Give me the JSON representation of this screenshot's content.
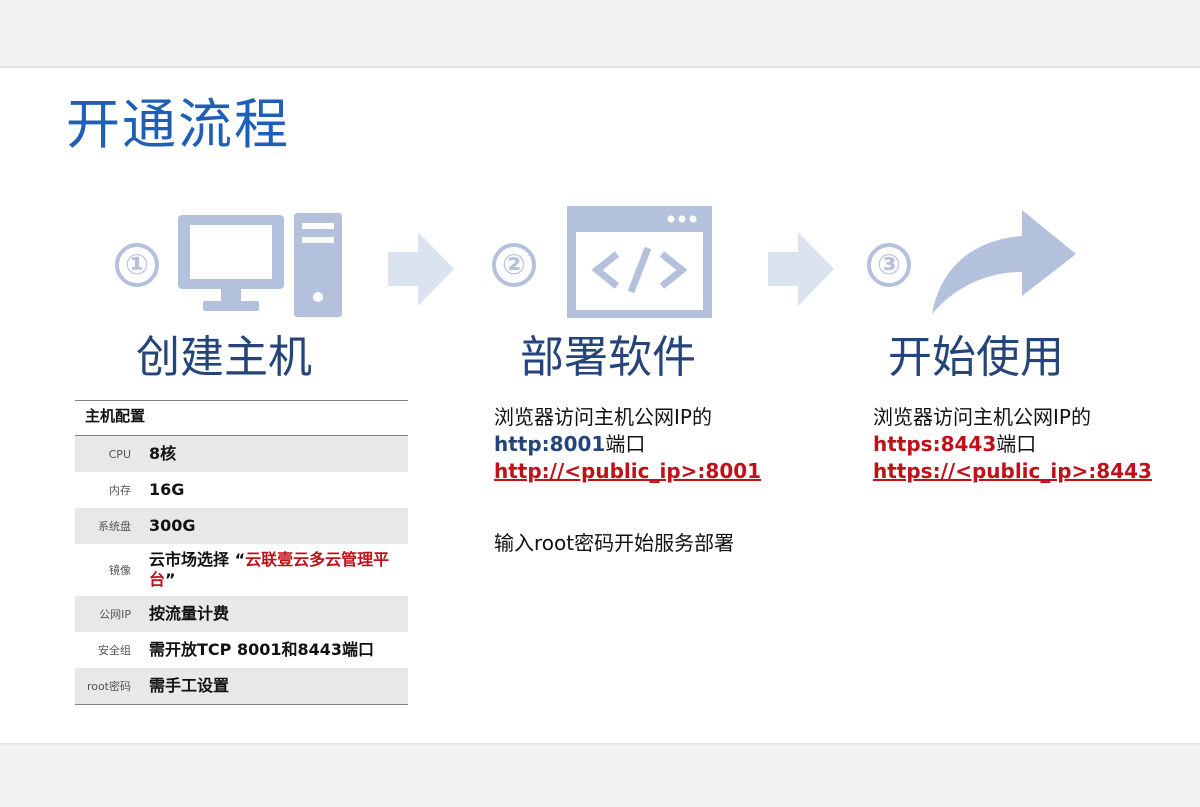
{
  "page": {
    "title": "开通流程"
  },
  "steps": [
    {
      "number": "①",
      "icon": "computer-icon",
      "title": "创建主机"
    },
    {
      "number": "②",
      "icon": "code-window-icon",
      "title": "部署软件",
      "desc_line1": "浏览器访问主机公网IP的",
      "desc_port": "http:8001",
      "desc_port_suffix": "端口",
      "desc_link": "http://<public_ip>:8001",
      "desc_extra": "输入root密码开始服务部署"
    },
    {
      "number": "③",
      "icon": "curved-arrow-icon",
      "title": "开始使用",
      "desc_line1": "浏览器访问主机公网IP的",
      "desc_port": "https:8443",
      "desc_port_suffix": "端口",
      "desc_link": "https://<public_ip>:8443"
    }
  ],
  "table": {
    "header": "主机配置",
    "rows": [
      {
        "key": "CPU",
        "value": "8核"
      },
      {
        "key": "内存",
        "value": "16G"
      },
      {
        "key": "系统盘",
        "value": "300G"
      },
      {
        "key": "镜像",
        "value_prefix": "云市场选择 “",
        "value_highlight": "云联壹云多云管理平台",
        "value_suffix": "”"
      },
      {
        "key": "公网IP",
        "value": "按流量计费"
      },
      {
        "key": "安全组",
        "value": "需开放TCP 8001和8443端口"
      },
      {
        "key": "root密码",
        "value": "需手工设置"
      }
    ]
  },
  "colors": {
    "title_blue": "#1f5fb5",
    "heading_navy": "#24447a",
    "icon_light": "#b4c1dd",
    "arrow_light": "#dbe3f0",
    "link_red": "#c0101a"
  }
}
